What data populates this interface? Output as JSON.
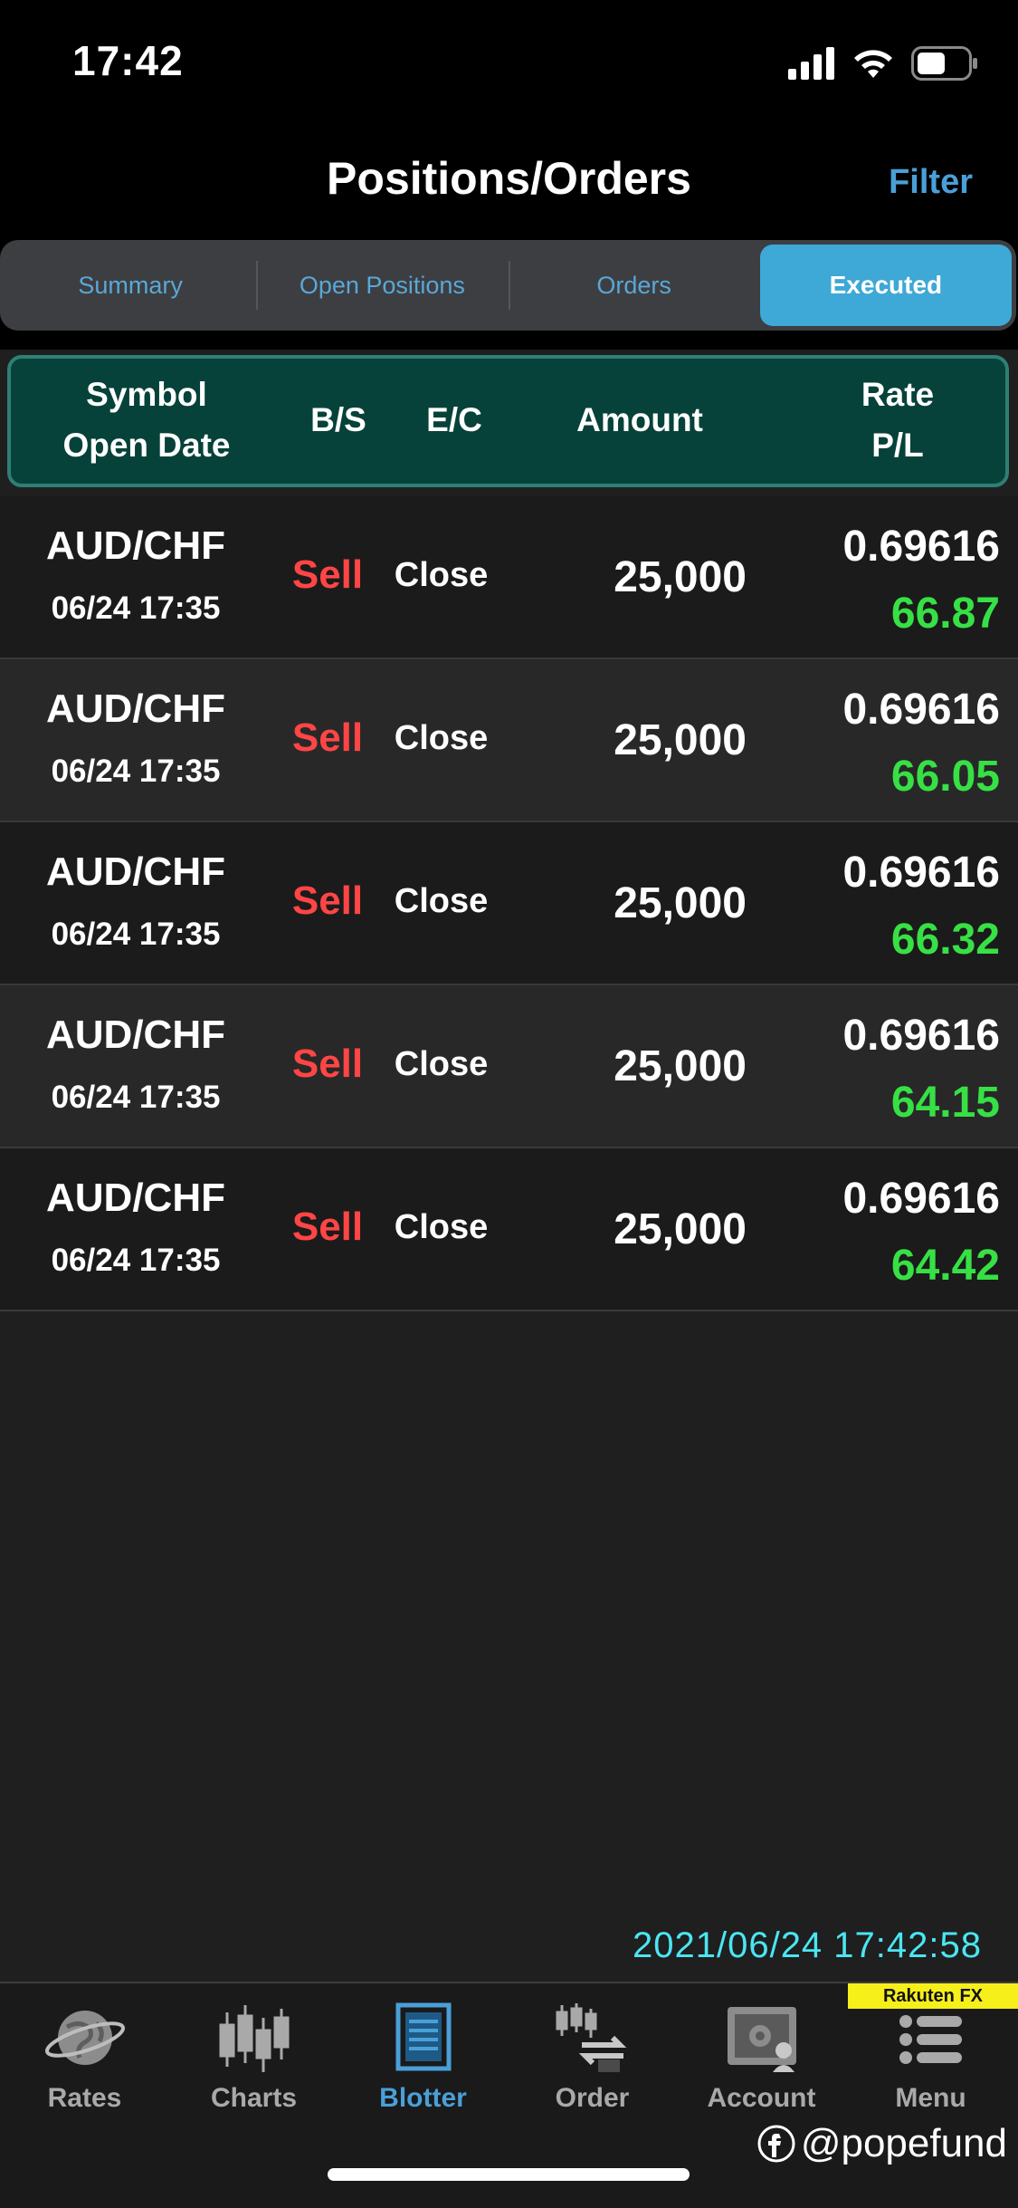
{
  "status_bar": {
    "time": "17:42"
  },
  "nav": {
    "title": "Positions/Orders",
    "filter_label": "Filter"
  },
  "segments": [
    {
      "label": "Summary"
    },
    {
      "label": "Open Positions"
    },
    {
      "label": "Orders"
    },
    {
      "label": "Executed"
    }
  ],
  "active_segment": "Executed",
  "columns": {
    "symbol": "Symbol",
    "open_date": "Open Date",
    "bs": "B/S",
    "ec": "E/C",
    "amount": "Amount",
    "rate": "Rate",
    "pl": "P/L"
  },
  "rows": [
    {
      "symbol": "AUD/CHF",
      "date": "06/24 17:35",
      "bs": "Sell",
      "ec": "Close",
      "amount": "25,000",
      "rate": "0.69616",
      "pl": "66.87"
    },
    {
      "symbol": "AUD/CHF",
      "date": "06/24 17:35",
      "bs": "Sell",
      "ec": "Close",
      "amount": "25,000",
      "rate": "0.69616",
      "pl": "66.05"
    },
    {
      "symbol": "AUD/CHF",
      "date": "06/24 17:35",
      "bs": "Sell",
      "ec": "Close",
      "amount": "25,000",
      "rate": "0.69616",
      "pl": "66.32"
    },
    {
      "symbol": "AUD/CHF",
      "date": "06/24 17:35",
      "bs": "Sell",
      "ec": "Close",
      "amount": "25,000",
      "rate": "0.69616",
      "pl": "64.15"
    },
    {
      "symbol": "AUD/CHF",
      "date": "06/24 17:35",
      "bs": "Sell",
      "ec": "Close",
      "amount": "25,000",
      "rate": "0.69616",
      "pl": "64.42"
    }
  ],
  "timestamp": "2021/06/24 17:42:58",
  "brand": "Rakuten FX",
  "tabs": [
    {
      "label": "Rates",
      "icon": "globe-icon"
    },
    {
      "label": "Charts",
      "icon": "candlestick-icon"
    },
    {
      "label": "Blotter",
      "icon": "blotter-icon"
    },
    {
      "label": "Order",
      "icon": "order-icon"
    },
    {
      "label": "Account",
      "icon": "safe-icon"
    },
    {
      "label": "Menu",
      "icon": "menu-icon"
    }
  ],
  "watermark": "@popefund",
  "colors": {
    "accent": "#3ea8d6",
    "sell": "#ff4545",
    "profit": "#37e045",
    "header_bg": "#064239",
    "timestamp": "#4ae6f2"
  }
}
